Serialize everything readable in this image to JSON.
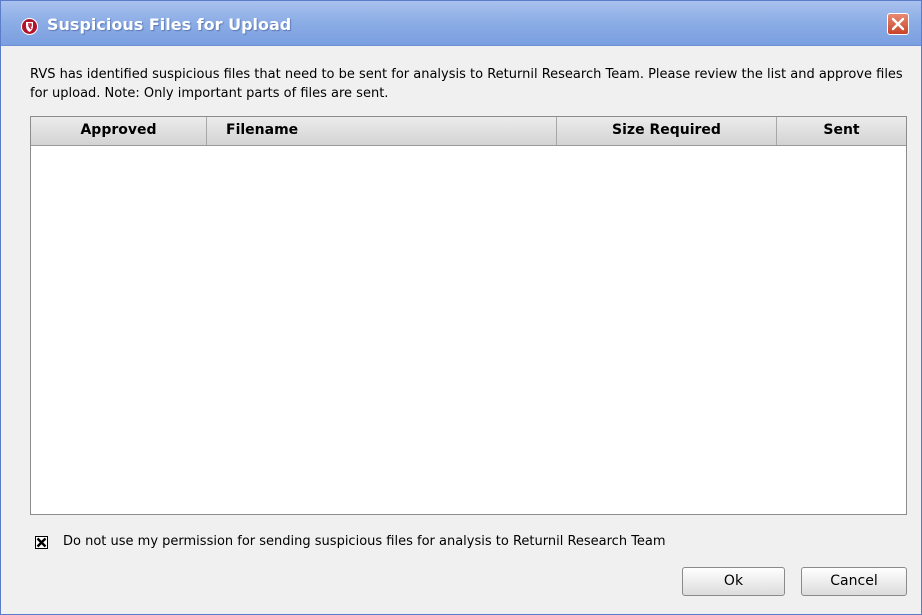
{
  "window": {
    "title": "Suspicious Files for Upload",
    "title_icon": "returnil-shield-icon",
    "close_icon": "close-icon",
    "titlebar_color": "#7a9fe0",
    "close_color": "#c8432a"
  },
  "description": "RVS has identified suspicious files that need to be sent for analysis to Returnil Research Team. Please review the list and approve files for upload. Note: Only important parts of files are sent.",
  "table": {
    "columns": [
      "Approved",
      "Filename",
      "Size Required",
      "Sent"
    ],
    "rows": []
  },
  "permission": {
    "checked": true,
    "label": "Do not use my permission for sending suspicious files for analysis to Returnil Research Team"
  },
  "buttons": {
    "ok": "Ok",
    "cancel": "Cancel"
  }
}
